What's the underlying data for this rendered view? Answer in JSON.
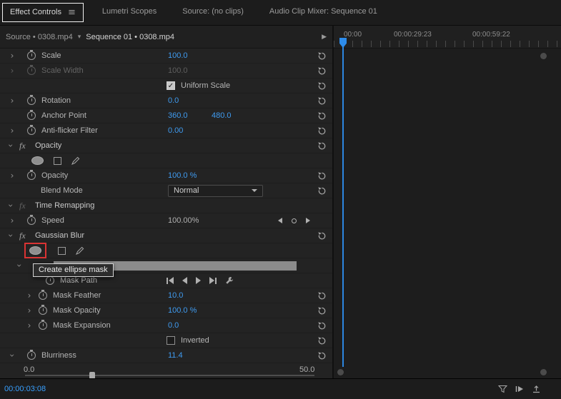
{
  "colors": {
    "accent_blue": "#2d8ceb",
    "value_blue": "#3f9bf0",
    "highlight_red": "#d93333"
  },
  "icons": {
    "panel_menu": "≡",
    "twirl": "›",
    "check": "✓",
    "chevron_down": "▾",
    "timeline_toggle": "▶",
    "fx": "fx"
  },
  "tabs": {
    "effect_controls": "Effect Controls",
    "lumetri_scopes": "Lumetri Scopes",
    "source": "Source: (no clips)",
    "audio_mixer": "Audio Clip Mixer: Sequence 01"
  },
  "header": {
    "source_tab": "Source • 0308.mp4",
    "sequence_tab": "Sequence 01 • 0308.mp4"
  },
  "ruler": {
    "t0": "00:00",
    "t1": "00:00:29:23",
    "t2": "00:00:59:22"
  },
  "motion": {
    "scale": {
      "label": "Scale",
      "value": "100.0"
    },
    "scale_width": {
      "label": "Scale Width",
      "value": "100.0"
    },
    "uniform_scale": {
      "label": "Uniform Scale",
      "checked": true
    },
    "rotation": {
      "label": "Rotation",
      "value": "0.0"
    },
    "anchor_point": {
      "label": "Anchor Point",
      "x": "360.0",
      "y": "480.0"
    },
    "anti_flicker": {
      "label": "Anti-flicker Filter",
      "value": "0.00"
    }
  },
  "opacity": {
    "section": "Opacity",
    "opacity": {
      "label": "Opacity",
      "value": "100.0 %"
    },
    "blend_mode": {
      "label": "Blend Mode",
      "value": "Normal"
    }
  },
  "time_remapping": {
    "section": "Time Remapping",
    "speed": {
      "label": "Speed",
      "value": "100.00%"
    }
  },
  "gaussian_blur": {
    "section": "Gaussian Blur",
    "tooltip": "Create ellipse mask",
    "mask_path": {
      "label": "Mask Path"
    },
    "mask_feather": {
      "label": "Mask Feather",
      "value": "10.0"
    },
    "mask_opacity": {
      "label": "Mask Opacity",
      "value": "100.0 %"
    },
    "mask_expansion": {
      "label": "Mask Expansion",
      "value": "0.0"
    },
    "inverted": {
      "label": "Inverted",
      "checked": false
    },
    "blurriness": {
      "label": "Blurriness",
      "value": "11.4"
    },
    "slider_min": "0.0",
    "slider_max": "50.0"
  },
  "footer": {
    "timecode": "00:00:03:08"
  }
}
